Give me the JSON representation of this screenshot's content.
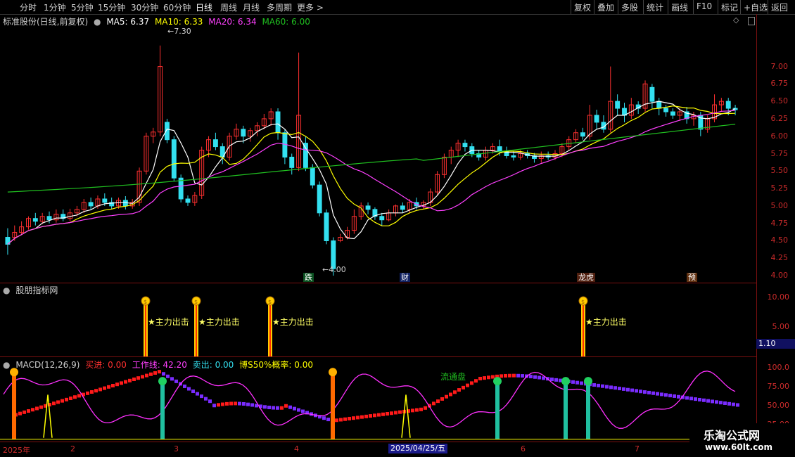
{
  "topbar": {
    "periods": [
      "分时",
      "1分钟",
      "5分钟",
      "15分钟",
      "30分钟",
      "60分钟",
      "日线",
      "周线",
      "月线",
      "多周期",
      "更多 >"
    ],
    "active_period": "日线",
    "actions": [
      "复权",
      "叠加",
      "多股",
      "统计",
      "画线",
      "F10",
      "标记",
      "+自选",
      "返回"
    ]
  },
  "main_header": {
    "title": "标准股份(日线,前复权)",
    "ma5": "MA5: 6.37",
    "ma10": "MA10: 6.33",
    "ma20": "MA20: 6.34",
    "ma60": "MA60: 6.00"
  },
  "price_axis": [
    "7.00",
    "6.75",
    "6.50",
    "6.25",
    "6.00",
    "5.75",
    "5.50",
    "5.25",
    "5.00",
    "4.75",
    "4.50",
    "4.25",
    "4.00"
  ],
  "annotations": {
    "high": "7.30",
    "low": "4.00"
  },
  "event_tags": [
    "跌",
    "财",
    "龙虎",
    "预"
  ],
  "indicator_header": {
    "title": "股朋指标网"
  },
  "indicator_axis": [
    "10.00",
    "5.00"
  ],
  "indicator_value": "1.10",
  "signal_label": "★主力出击",
  "macd_header": {
    "name": "MACD(12,26,9)",
    "buy": "买进: 0.00",
    "work": "工作线: 42.20",
    "sell": "卖出: 0.00",
    "prob": "博S50%概率: 0.00"
  },
  "macd_axis": [
    "100.0",
    "75.00",
    "50.00",
    "25.00"
  ],
  "float_label": "流通盘",
  "x_axis": [
    "2025年",
    "2",
    "3",
    "4",
    "2025/04/25/五",
    "6",
    "7"
  ],
  "logo": {
    "line1": "乐淘公式网",
    "line2": "www.60lt.com"
  },
  "colors": {
    "up": "#ff3030",
    "down": "#33e0f0",
    "ma5": "#ffffff",
    "ma10": "#ffff00",
    "ma20": "#ff40ff",
    "ma60": "#20c020",
    "axis": "#cc2b2b"
  },
  "chart_data": {
    "type": "candlestick",
    "price_range": [
      4.0,
      7.3
    ],
    "candles": [
      [
        4.55,
        4.45,
        4.68,
        4.3
      ],
      [
        4.55,
        4.62,
        4.72,
        4.5
      ],
      [
        4.62,
        4.7,
        4.78,
        4.58
      ],
      [
        4.7,
        4.82,
        4.85,
        4.66
      ],
      [
        4.82,
        4.78,
        4.9,
        4.72
      ],
      [
        4.78,
        4.85,
        4.9,
        4.74
      ],
      [
        4.85,
        4.8,
        4.92,
        4.75
      ],
      [
        4.8,
        4.88,
        4.95,
        4.76
      ],
      [
        4.88,
        4.82,
        4.95,
        4.78
      ],
      [
        4.82,
        4.9,
        4.96,
        4.78
      ],
      [
        4.9,
        4.95,
        5.0,
        4.85
      ],
      [
        4.95,
        5.05,
        5.1,
        4.9
      ],
      [
        5.05,
        5.0,
        5.12,
        4.95
      ],
      [
        5.0,
        5.1,
        5.15,
        4.96
      ],
      [
        5.1,
        5.05,
        5.18,
        5.0
      ],
      [
        5.05,
        5.0,
        5.12,
        4.95
      ],
      [
        5.0,
        5.08,
        5.12,
        4.96
      ],
      [
        5.08,
        5.0,
        5.14,
        4.95
      ],
      [
        5.0,
        5.05,
        5.1,
        4.96
      ],
      [
        5.05,
        5.5,
        5.55,
        5.0
      ],
      [
        5.5,
        6.0,
        6.05,
        5.45
      ],
      [
        6.0,
        6.06,
        6.12,
        5.9
      ],
      [
        6.06,
        7.0,
        7.3,
        6.0
      ],
      [
        6.2,
        5.95,
        6.25,
        5.9
      ],
      [
        5.95,
        5.4,
        6.0,
        5.35
      ],
      [
        5.4,
        5.1,
        5.45,
        5.05
      ],
      [
        5.1,
        5.05,
        5.15,
        5.0
      ],
      [
        5.05,
        5.15,
        5.2,
        5.0
      ],
      [
        5.15,
        5.8,
        5.85,
        5.1
      ],
      [
        5.8,
        5.95,
        6.0,
        5.7
      ],
      [
        5.95,
        5.85,
        6.05,
        5.8
      ],
      [
        5.85,
        5.7,
        5.9,
        5.6
      ],
      [
        5.7,
        6.0,
        6.05,
        5.65
      ],
      [
        6.0,
        6.1,
        6.18,
        5.95
      ],
      [
        6.1,
        6.0,
        6.15,
        5.9
      ],
      [
        6.0,
        6.08,
        6.12,
        5.92
      ],
      [
        6.08,
        6.15,
        6.2,
        6.0
      ],
      [
        6.15,
        6.25,
        6.32,
        6.1
      ],
      [
        6.25,
        6.35,
        6.4,
        6.15
      ],
      [
        6.35,
        6.05,
        6.4,
        5.95
      ],
      [
        6.05,
        5.7,
        6.1,
        5.6
      ],
      [
        5.7,
        5.55,
        5.75,
        5.45
      ],
      [
        5.55,
        6.3,
        7.2,
        5.5
      ],
      [
        5.9,
        5.55,
        6.0,
        5.5
      ],
      [
        5.55,
        5.3,
        5.6,
        5.25
      ],
      [
        5.3,
        4.9,
        5.35,
        4.85
      ],
      [
        4.9,
        4.5,
        4.95,
        4.45
      ],
      [
        4.5,
        4.1,
        4.55,
        4.0
      ],
      [
        4.5,
        4.55,
        4.6,
        4.48
      ],
      [
        4.55,
        4.65,
        4.7,
        4.52
      ],
      [
        4.65,
        4.85,
        4.95,
        4.6
      ],
      [
        4.85,
        5.0,
        5.05,
        4.8
      ],
      [
        5.0,
        4.95,
        5.05,
        4.88
      ],
      [
        4.95,
        4.85,
        4.98,
        4.8
      ],
      [
        4.85,
        4.8,
        4.9,
        4.72
      ],
      [
        4.8,
        4.9,
        4.95,
        4.78
      ],
      [
        4.9,
        5.0,
        5.02,
        4.85
      ],
      [
        5.0,
        4.95,
        5.05,
        4.9
      ],
      [
        4.95,
        5.05,
        5.1,
        4.9
      ],
      [
        5.05,
        5.0,
        5.12,
        4.95
      ],
      [
        5.0,
        5.05,
        5.08,
        4.96
      ],
      [
        5.05,
        5.2,
        5.25,
        5.0
      ],
      [
        5.2,
        5.45,
        5.5,
        5.15
      ],
      [
        5.45,
        5.7,
        5.75,
        5.4
      ],
      [
        5.7,
        5.8,
        5.85,
        5.6
      ],
      [
        5.8,
        5.9,
        5.95,
        5.7
      ],
      [
        5.9,
        5.85,
        5.95,
        5.78
      ],
      [
        5.85,
        5.75,
        5.9,
        5.7
      ],
      [
        5.75,
        5.7,
        5.8,
        5.65
      ],
      [
        5.7,
        5.8,
        5.85,
        5.65
      ],
      [
        5.8,
        5.85,
        5.9,
        5.75
      ],
      [
        5.85,
        5.78,
        5.95,
        5.72
      ],
      [
        5.78,
        5.72,
        5.85,
        5.68
      ],
      [
        5.72,
        5.7,
        5.78,
        5.65
      ],
      [
        5.7,
        5.75,
        5.8,
        5.66
      ],
      [
        5.75,
        5.72,
        5.8,
        5.68
      ],
      [
        5.72,
        5.68,
        5.76,
        5.62
      ],
      [
        5.68,
        5.72,
        5.78,
        5.62
      ],
      [
        5.72,
        5.7,
        5.78,
        5.66
      ],
      [
        5.7,
        5.75,
        5.8,
        5.66
      ],
      [
        5.75,
        5.85,
        5.9,
        5.7
      ],
      [
        5.85,
        5.95,
        6.0,
        5.8
      ],
      [
        5.95,
        6.05,
        6.1,
        5.9
      ],
      [
        6.05,
        6.0,
        6.12,
        5.95
      ],
      [
        6.0,
        6.3,
        6.45,
        5.95
      ],
      [
        6.3,
        6.2,
        6.38,
        6.1
      ],
      [
        6.2,
        6.1,
        6.3,
        6.05
      ],
      [
        6.1,
        6.5,
        7.0,
        6.05
      ],
      [
        6.5,
        6.4,
        6.6,
        6.3
      ],
      [
        6.4,
        6.3,
        6.48,
        6.2
      ],
      [
        6.3,
        6.45,
        6.55,
        6.25
      ],
      [
        6.45,
        6.4,
        6.5,
        6.32
      ],
      [
        6.4,
        6.75,
        6.8,
        6.35
      ],
      [
        6.7,
        6.5,
        6.75,
        6.4
      ],
      [
        6.5,
        6.4,
        6.55,
        6.3
      ],
      [
        6.4,
        6.35,
        6.45,
        6.28
      ],
      [
        6.35,
        6.3,
        6.4,
        6.25
      ],
      [
        6.3,
        6.35,
        6.4,
        6.22
      ],
      [
        6.35,
        6.25,
        6.42,
        6.18
      ],
      [
        6.25,
        6.3,
        6.35,
        6.15
      ],
      [
        6.3,
        6.1,
        6.35,
        6.0
      ],
      [
        6.1,
        6.25,
        6.3,
        6.05
      ],
      [
        6.25,
        6.45,
        6.6,
        6.2
      ],
      [
        6.45,
        6.5,
        6.55,
        6.35
      ],
      [
        6.5,
        6.4,
        6.55,
        6.3
      ],
      [
        6.4,
        6.38,
        6.45,
        6.3
      ]
    ],
    "signals_count": 4
  }
}
